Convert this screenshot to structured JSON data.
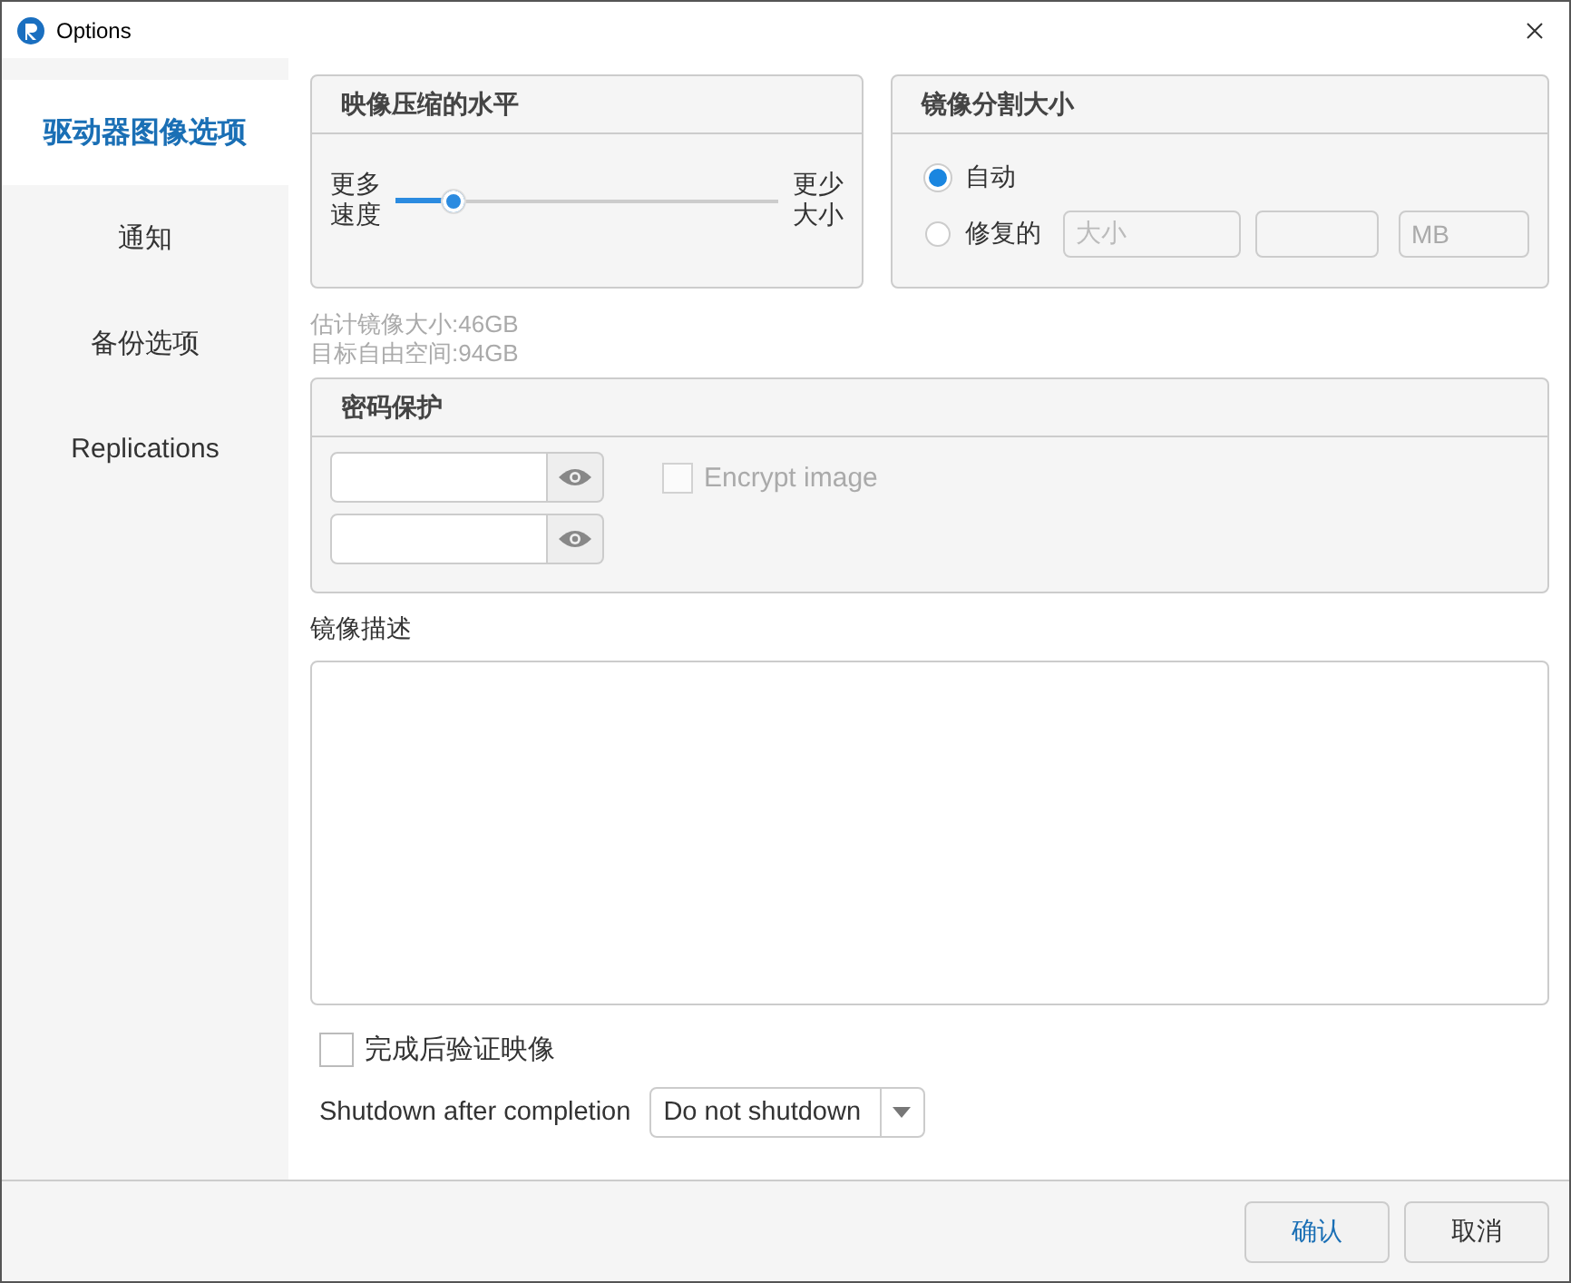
{
  "window": {
    "title": "Options"
  },
  "sidebar": {
    "items": [
      {
        "label": "驱动器图像选项",
        "selected": true
      },
      {
        "label": "通知",
        "selected": false
      },
      {
        "label": "备份选项",
        "selected": false
      },
      {
        "label": "Replications",
        "selected": false
      }
    ]
  },
  "compression": {
    "title": "映像压缩的水平",
    "left_label": "更多速度",
    "right_label": "更少大小",
    "level": 0.15
  },
  "split": {
    "title": "镜像分割大小",
    "options": [
      {
        "label": "自动",
        "selected": true
      },
      {
        "label": "修复的",
        "selected": false
      }
    ],
    "size_placeholder": "大小",
    "unit": "MB"
  },
  "estimates": [
    "估计镜像大小:46GB",
    "目标自由空间:94GB"
  ],
  "password": {
    "title": "密码保护",
    "encrypt": {
      "label": "Encrypt image",
      "checked": false,
      "disabled": true
    }
  },
  "description": {
    "label": "镜像描述"
  },
  "verify": {
    "label": "完成后验证映像",
    "checked": false
  },
  "shutdown": {
    "label": "Shutdown after completion",
    "value": "Do not shutdown"
  },
  "buttons": [
    "确认",
    "取消"
  ]
}
